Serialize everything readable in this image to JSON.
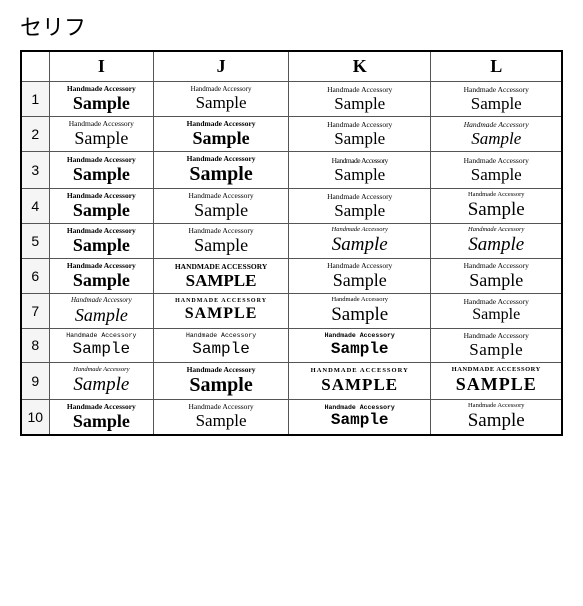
{
  "title": "セリフ",
  "columns": [
    "",
    "I",
    "J",
    "K",
    "L"
  ],
  "top_text": "Handmade Accessory",
  "main_text": "Sample",
  "rows": [
    {
      "num": "1",
      "cells": [
        {
          "col": "I",
          "top": "Handmade Accessory",
          "main": "Sample",
          "style": "r1-I"
        },
        {
          "col": "J",
          "top": "Handmade Accessory",
          "main": "Sample",
          "style": "r1-J"
        },
        {
          "col": "K",
          "top": "Handmade Accessory",
          "main": "Sample",
          "style": "r1-K"
        },
        {
          "col": "L",
          "top": "Handmade Accessory",
          "main": "Sample",
          "style": "r1-L"
        }
      ]
    },
    {
      "num": "2",
      "cells": [
        {
          "col": "I",
          "top": "Handmade Accessory",
          "main": "Sample",
          "style": "r2-I"
        },
        {
          "col": "J",
          "top": "Handmade Accessory",
          "main": "Sample",
          "style": "r2-J"
        },
        {
          "col": "K",
          "top": "Handmade Accessory",
          "main": "Sample",
          "style": "r2-K"
        },
        {
          "col": "L",
          "top": "Handmade Accessory",
          "main": "Sample",
          "style": "r2-L"
        }
      ]
    },
    {
      "num": "3",
      "cells": [
        {
          "col": "I",
          "top": "Handmade Accessory",
          "main": "Sample",
          "style": "r3-I"
        },
        {
          "col": "J",
          "top": "Handmade Accessory",
          "main": "Sample",
          "style": "r3-J"
        },
        {
          "col": "K",
          "top": "Handmade Accessory",
          "main": "Sample",
          "style": "r3-K"
        },
        {
          "col": "L",
          "top": "Handmade Accessory",
          "main": "Sample",
          "style": "r3-L"
        }
      ]
    },
    {
      "num": "4",
      "cells": [
        {
          "col": "I",
          "top": "Handmade Accessory",
          "main": "Sample",
          "style": "r4-I"
        },
        {
          "col": "J",
          "top": "Handmade Accessory",
          "main": "Sample",
          "style": "r4-J"
        },
        {
          "col": "K",
          "top": "Handmade Accessory",
          "main": "Sample",
          "style": "r4-K"
        },
        {
          "col": "L",
          "top": "Handmade Accessory",
          "main": "Sample",
          "style": "r4-L"
        }
      ]
    },
    {
      "num": "5",
      "cells": [
        {
          "col": "I",
          "top": "Handmade Accessory",
          "main": "Sample",
          "style": "r5-I"
        },
        {
          "col": "J",
          "top": "Handmade Accessory",
          "main": "Sample",
          "style": "r5-J"
        },
        {
          "col": "K",
          "top": "Handmade Accessory",
          "main": "Sample",
          "style": "r5-K"
        },
        {
          "col": "L",
          "top": "Handmade Accessory",
          "main": "Sample",
          "style": "r5-L"
        }
      ]
    },
    {
      "num": "6",
      "cells": [
        {
          "col": "I",
          "top": "Handmade Accessory",
          "main": "Sample",
          "style": "r6-I"
        },
        {
          "col": "J",
          "top": "HANDMADE ACCESSORY",
          "main": "SAMPLE",
          "style": "r6-J"
        },
        {
          "col": "K",
          "top": "Handmade Accessory",
          "main": "Sample",
          "style": "r6-K"
        },
        {
          "col": "L",
          "top": "Handmade Accessory",
          "main": "Sample",
          "style": "r6-L"
        }
      ]
    },
    {
      "num": "7",
      "cells": [
        {
          "col": "I",
          "top": "Handmade Accessory",
          "main": "Sample",
          "style": "r7-I"
        },
        {
          "col": "J",
          "top": "HANDMADE ACCESSORY",
          "main": "SAMPLE",
          "style": "r7-J"
        },
        {
          "col": "K",
          "top": "Handmade Accessory",
          "main": "Sample",
          "style": "r7-K"
        },
        {
          "col": "L",
          "top": "Handmade Accessory",
          "main": "Sample",
          "style": "r7-L"
        }
      ]
    },
    {
      "num": "8",
      "cells": [
        {
          "col": "I",
          "top": "Handmade Accessory",
          "main": "Sample",
          "style": "r8-I"
        },
        {
          "col": "J",
          "top": "Handmade Accessory",
          "main": "Sample",
          "style": "r8-J"
        },
        {
          "col": "K",
          "top": "Handmade Accessory",
          "main": "Sample",
          "style": "r8-K"
        },
        {
          "col": "L",
          "top": "Handmade Accessory",
          "main": "Sample",
          "style": "r8-L"
        }
      ]
    },
    {
      "num": "9",
      "cells": [
        {
          "col": "I",
          "top": "Handmade Accessory",
          "main": "Sample",
          "style": "r9-I"
        },
        {
          "col": "J",
          "top": "Handmade Accessory",
          "main": "Sample",
          "style": "r9-J"
        },
        {
          "col": "K",
          "top": "HANDMADE ACCESSORY",
          "main": "SAMPLE",
          "style": "r9-K"
        },
        {
          "col": "L",
          "top": "HANDMADE ACCESSORY",
          "main": "SAMPLE",
          "style": "r9-L"
        }
      ]
    },
    {
      "num": "10",
      "cells": [
        {
          "col": "I",
          "top": "Handmade Accessory",
          "main": "Sample",
          "style": "r10-I"
        },
        {
          "col": "J",
          "top": "Handmade Accessory",
          "main": "Sample",
          "style": "r10-J"
        },
        {
          "col": "K",
          "top": "Handmade Accessory",
          "main": "Sample",
          "style": "r10-K"
        },
        {
          "col": "L",
          "top": "Handmade Accessory",
          "main": "Sample",
          "style": "r10-L"
        }
      ]
    }
  ]
}
